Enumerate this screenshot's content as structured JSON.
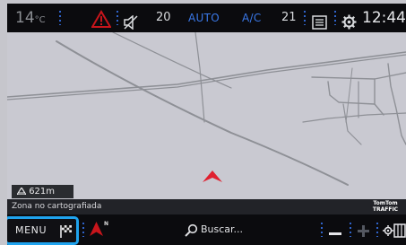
{
  "status_bar": {
    "temperature_value": "14",
    "temperature_unit": "°C",
    "fan_level": "20",
    "climate_mode": "AUTO",
    "ac_label": "A/C",
    "volume_level": "21",
    "time": "12:44"
  },
  "map": {
    "scale_value": "621m",
    "status_message": "Zona no cartografiada",
    "traffic_brand": "TomTom",
    "traffic_label": "TRAFFIC"
  },
  "bottom_bar": {
    "menu_label": "MENU",
    "north_label": "N",
    "search_placeholder": "Buscar..."
  },
  "colors": {
    "accent": "#1fa3ee",
    "auto_text": "#3a79ea",
    "warning": "#c8151b",
    "position_arrow": "#e0202f",
    "map_background": "#c9c9d1",
    "road": "#8e9096"
  },
  "icons": [
    "hazard-icon",
    "mute-icon",
    "nav-flag-icon",
    "north-arrow-icon",
    "search-icon",
    "settings-icon",
    "notes-icon",
    "position-arrow-icon"
  ]
}
